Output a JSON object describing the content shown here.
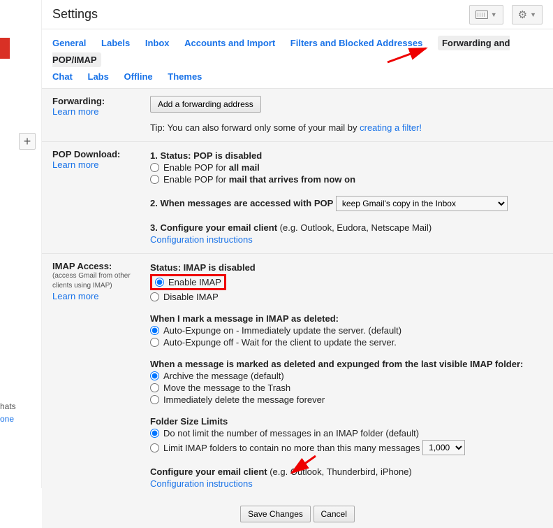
{
  "header": {
    "title": "Settings"
  },
  "tabs": {
    "general": "General",
    "labels": "Labels",
    "inbox": "Inbox",
    "accounts": "Accounts and Import",
    "filters": "Filters and Blocked Addresses",
    "forwarding": "Forwarding and POP/IMAP",
    "chat": "Chat",
    "labs": "Labs",
    "offline": "Offline",
    "themes": "Themes"
  },
  "left": {
    "chats": "hats",
    "one": "one",
    "plus": "+"
  },
  "forwarding": {
    "label": "Forwarding:",
    "learn": "Learn more",
    "add_btn": "Add a forwarding address",
    "tip_prefix": "Tip: You can also forward only some of your mail by ",
    "tip_link": "creating a filter!"
  },
  "pop": {
    "label": "POP Download:",
    "learn": "Learn more",
    "s1_prefix": "1.  Status: ",
    "s1_status": "POP is disabled",
    "enable_all_prefix": "Enable POP for ",
    "enable_all_bold": "all mail",
    "enable_now_prefix": "Enable POP for ",
    "enable_now_bold": "mail that arrives from now on",
    "s2_label": "2.  When messages are accessed with POP",
    "s2_select": "keep Gmail's copy in the Inbox",
    "s3_prefix": "3.  Configure your email client ",
    "s3_suffix": "(e.g. Outlook, Eudora, Netscape Mail)",
    "s3_link": "Configuration instructions"
  },
  "imap": {
    "label": "IMAP Access:",
    "sub": "(access Gmail from other clients using IMAP)",
    "learn": "Learn more",
    "status_prefix": "Status: ",
    "status": "IMAP is disabled",
    "enable": "Enable IMAP",
    "disable": "Disable IMAP",
    "deleted_header": "When I mark a message in IMAP as deleted:",
    "exp_on": "Auto-Expunge on - Immediately update the server. (default)",
    "exp_off": "Auto-Expunge off - Wait for the client to update the server.",
    "purge_header": "When a message is marked as deleted and expunged from the last visible IMAP folder:",
    "purge_archive": "Archive the message (default)",
    "purge_trash": "Move the message to the Trash",
    "purge_delete": "Immediately delete the message forever",
    "limits_header": "Folder Size Limits",
    "limits_nolimit": "Do not limit the number of messages in an IMAP folder (default)",
    "limits_limit": "Limit IMAP folders to contain no more than this many messages",
    "limits_select": "1,000",
    "conf_prefix": "Configure your email client ",
    "conf_suffix": "(e.g. Outlook, Thunderbird, iPhone)",
    "conf_link": "Configuration instructions"
  },
  "footer": {
    "save": "Save Changes",
    "cancel": "Cancel"
  }
}
